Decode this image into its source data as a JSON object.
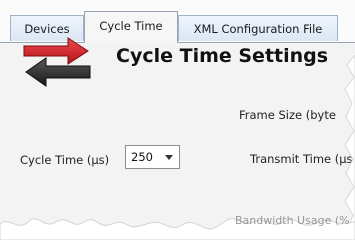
{
  "tabs": [
    {
      "label": "Devices"
    },
    {
      "label": "Cycle Time"
    },
    {
      "label": "XML Configuration File"
    }
  ],
  "header": {
    "title": "Cycle Time Settings",
    "icon": "exchange-arrows-icon"
  },
  "fields": {
    "frame_size_label": "Frame Size (byte",
    "transmit_time_label": "Transmit Time (μs",
    "cycle_time_label": "Cycle Time (µs)",
    "cycle_time_value": "250",
    "bandwidth_label": "Bandwidth Usage (%"
  },
  "colors": {
    "arrow_top": "#d7262b",
    "arrow_bottom": "#2d2d2d",
    "tab_border": "#9fb3cc"
  }
}
